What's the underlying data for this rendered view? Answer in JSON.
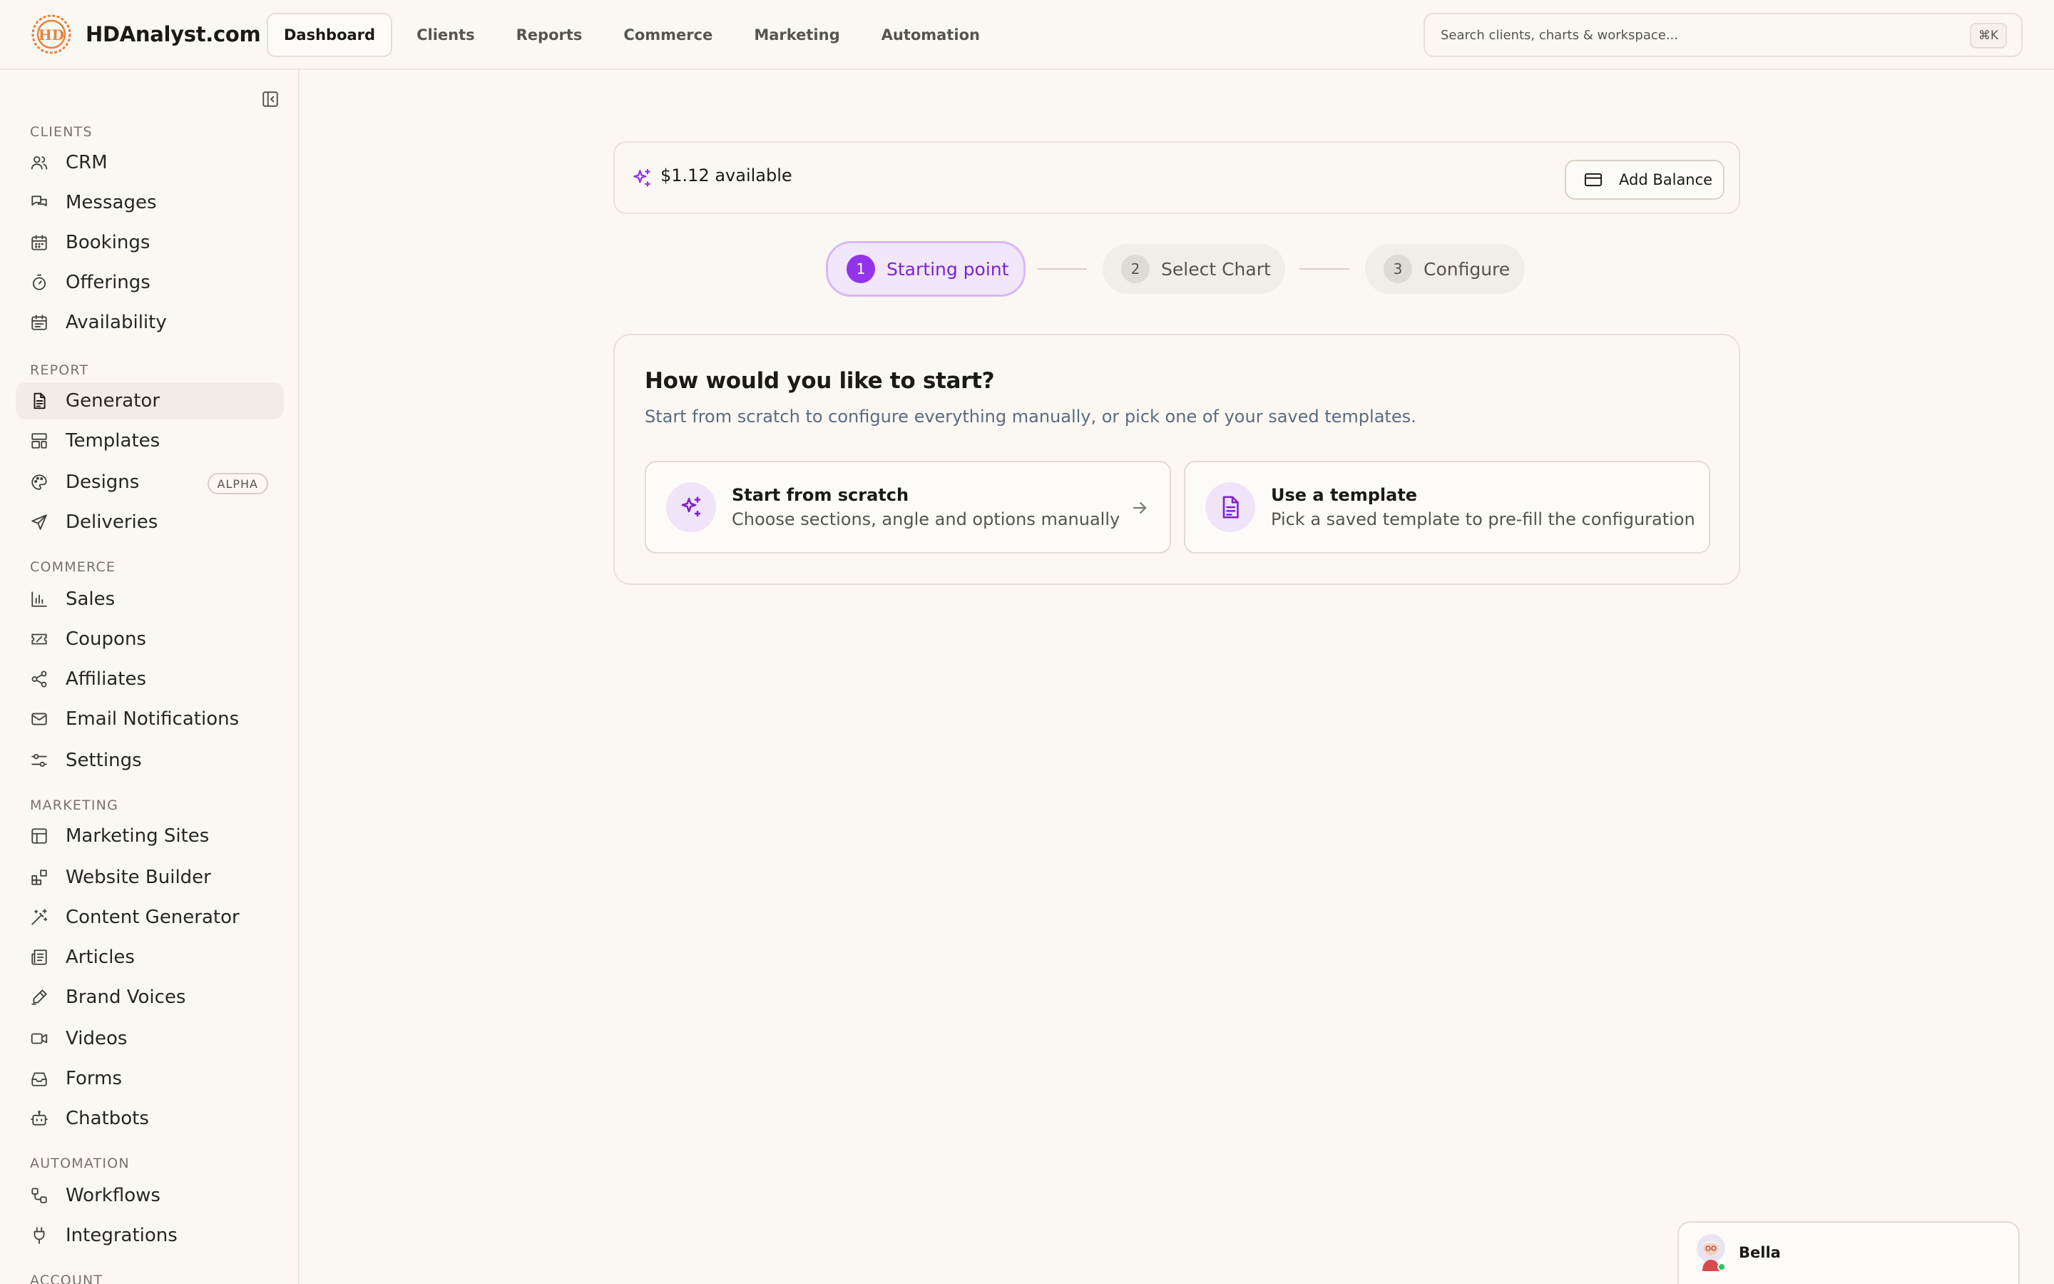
{
  "app": {
    "brand_name": "HDAnalyst.com",
    "logo_text": "HD"
  },
  "topnav": [
    "Dashboard",
    "Clients",
    "Reports",
    "Commerce",
    "Marketing",
    "Automation"
  ],
  "search": {
    "placeholder": "Search clients, charts & workspace...",
    "shortcut": "⌘K"
  },
  "sidebar": {
    "sections": {
      "clients": "CLIENTS",
      "report": "REPORT",
      "commerce": "COMMERCE",
      "marketing": "MARKETING",
      "automation": "AUTOMATION",
      "account": "ACCOUNT"
    },
    "items": {
      "crm": "CRM",
      "messages": "Messages",
      "bookings": "Bookings",
      "offerings": "Offerings",
      "availability": "Availability",
      "generator": "Generator",
      "templates": "Templates",
      "designs": "Designs",
      "designs_badge": "ALPHA",
      "deliveries": "Deliveries",
      "sales": "Sales",
      "coupons": "Coupons",
      "affiliates": "Affiliates",
      "email_notifications": "Email Notifications",
      "settings": "Settings",
      "marketing_sites": "Marketing Sites",
      "website_builder": "Website Builder",
      "content_generator": "Content Generator",
      "articles": "Articles",
      "brand_voices": "Brand Voices",
      "videos": "Videos",
      "forms": "Forms",
      "chatbots": "Chatbots",
      "workflows": "Workflows",
      "integrations": "Integrations"
    },
    "active_item": "Generator"
  },
  "balance": {
    "text": "$1.12 available",
    "button_label": "Add Balance"
  },
  "stepper": {
    "steps": [
      {
        "num": "1",
        "label": "Starting point"
      },
      {
        "num": "2",
        "label": "Select Chart"
      },
      {
        "num": "3",
        "label": "Configure"
      }
    ],
    "active_step": 1
  },
  "start": {
    "title": "How would you like to start?",
    "subtitle": "Start from scratch to configure everything manually, or pick one of your saved templates.",
    "options": [
      {
        "title": "Start from scratch",
        "desc": "Choose sections, angle and options manually"
      },
      {
        "title": "Use a template",
        "desc": "Pick a saved template to pre-fill the configuration"
      }
    ]
  },
  "user": {
    "name": "Bella",
    "status": "online"
  },
  "colors": {
    "accent": "#9333ea",
    "accent_bg": "#efe4f8",
    "brand_orange": "#e8823a",
    "online": "#22c55e"
  }
}
